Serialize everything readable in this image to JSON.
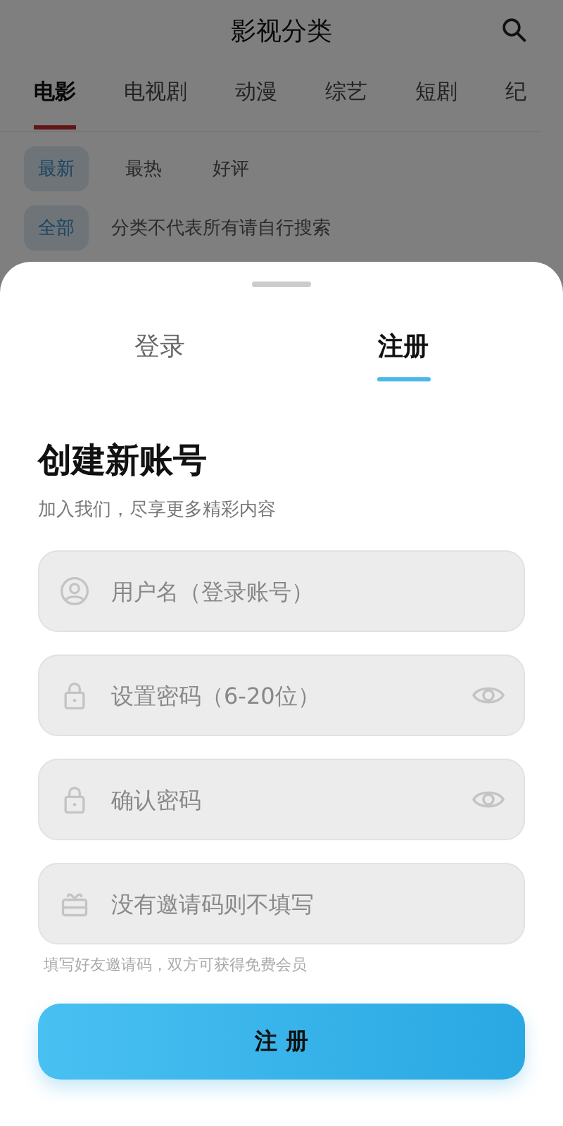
{
  "header": {
    "title": "影视分类"
  },
  "category_tabs": [
    {
      "label": "电影",
      "selected": true
    },
    {
      "label": "电视剧",
      "selected": false
    },
    {
      "label": "动漫",
      "selected": false
    },
    {
      "label": "综艺",
      "selected": false
    },
    {
      "label": "短剧",
      "selected": false
    },
    {
      "label": "纪",
      "selected": false
    }
  ],
  "sort_chips": [
    {
      "label": "最新",
      "selected": true
    },
    {
      "label": "最热",
      "selected": false
    },
    {
      "label": "好评",
      "selected": false
    }
  ],
  "filter_row": {
    "chip": {
      "label": "全部",
      "selected": true
    },
    "note": "分类不代表所有请自行搜索"
  },
  "sheet": {
    "tabs": [
      {
        "label": "登录",
        "selected": false
      },
      {
        "label": "注册",
        "selected": true
      }
    ],
    "heading": "创建新账号",
    "subheading": "加入我们，尽享更多精彩内容",
    "fields": [
      {
        "kind": "user",
        "placeholder": "用户名（登录账号）",
        "reveal": false
      },
      {
        "kind": "lock",
        "placeholder": "设置密码（6-20位）",
        "reveal": true
      },
      {
        "kind": "lock",
        "placeholder": "确认密码",
        "reveal": true
      },
      {
        "kind": "gift",
        "placeholder": "没有邀请码则不填写",
        "reveal": false
      }
    ],
    "hint": "填写好友邀请码，双方可获得免费会员",
    "button": "注 册"
  }
}
